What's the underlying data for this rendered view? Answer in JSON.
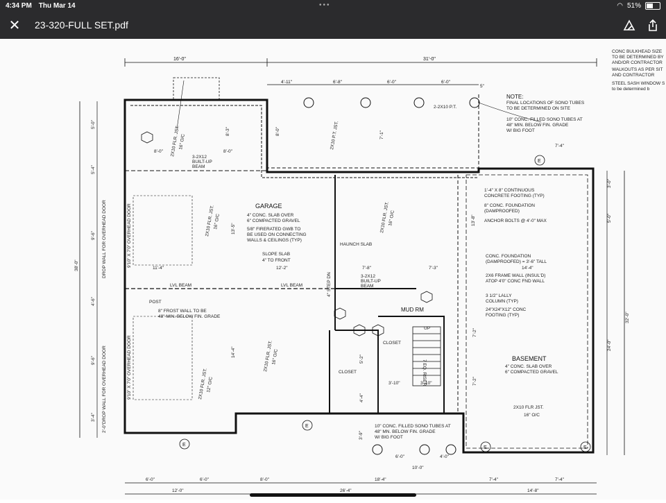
{
  "status_bar": {
    "time": "4:34 PM",
    "date": "Thu Mar 14",
    "battery": "51%",
    "battery_level": 0.51,
    "center_dots": "•••"
  },
  "toolbar": {
    "title": "23-320-FULL SET.pdf",
    "close_icon": "close-icon",
    "markup_icon": "markup-pen-icon",
    "share_icon": "share-icon"
  },
  "drawing": {
    "top_dims": {
      "left": "16'-0\"",
      "right": "31'-0\""
    },
    "top_sub_dims": [
      "4'-11\"",
      "6'-8\"",
      "6'-0\"",
      "6'-0\"",
      "5\""
    ],
    "right_notes": [
      "CONC BULKHEAD SIZE",
      "TO BE DETERMINED BY",
      "AND/OR CONTRACTOR",
      "WALKOUTS AS PER SIT",
      "AND CONTRACTOR",
      "STEEL SASH WINDOW S",
      "to be determined b"
    ],
    "note": {
      "heading": "NOTE:",
      "line1": "FINAL LOCATIONS OF SONO TUBES",
      "line2": "TO BE DETERMINED ON SITE"
    },
    "sono_note_top": [
      "10\" CONC. FILLED SONO TUBES AT",
      "48\" MIN. BELOW FIN. GRADE",
      "W/ BIG FOOT"
    ],
    "ptb": "2-2X10 P.T.",
    "garage": {
      "title": "GARAGE",
      "slab1": "4\" CONC. SLAB OVER",
      "slab2": "6\" COMPACTED GRAVEL",
      "gwb1": "5/8\" FIRERATED GWB TO",
      "gwb2": "BE USED ON CONNECTING",
      "gwb3": "WALLS & CEILINGS (TYP)",
      "slope1": "SLOPE SLAB",
      "slope2": "4\" TO FRONT"
    },
    "basement": {
      "title": "BASEMENT",
      "slab1": "4\" CONC. SLAB OVER",
      "slab2": "6\" COMPACTED GRAVEL",
      "joist": "2X10 FLR JST.",
      "oc": "16\" O/C"
    },
    "basement_notes": [
      "1'-4\" X 8\" CONTINUOUS",
      "CONCRETE FOOTING (TYP)",
      "8\" CONC. FOUNDATION",
      "(DAMPROOFED)",
      "ANCHOR BOLTS @ 4'-0\" MAX",
      "CONC. FOUNDATION",
      "(DAMPROOFED) = 3'-6\" TALL",
      "2X6 FRAME WALL (INSUL'D)",
      "ATOP 4'0\" CONC FND WALL",
      "3 1/2\" LALLY",
      "COLUMN (TYP)",
      "24\"X24\"X12\" CONC",
      "FOOTING (TYP)"
    ],
    "labels": {
      "lvl_beam": "LVL BEAM",
      "built_up1": "3-2X12",
      "built_up2": "BUILT-UP",
      "built_up3": "BEAM",
      "haunch": "HAUNCH SLAB",
      "mud_rm": "MUD RM",
      "closet": "CLOSET",
      "up": "UP",
      "post": "POST",
      "frost1": "8\" FROST WALL TO BE",
      "frost2": "48\" MIN. BELOW FIN. GRADE",
      "riser": "7 EQ. RISER",
      "step": "4\" STEP DN",
      "flr_jst": "2X10 FLR. JST.",
      "oc16": "16\" O/C",
      "oc12": "12\" O/C",
      "pt_jst": "2X10 P.T. JST.",
      "drop1": "DROP WALL FOR OVERHEAD DOOR",
      "door": "9'10\" X 7'0\" OVERHEAD DOOR"
    },
    "sono_note_bottom": [
      "10\" CONC. FILLED SONO TUBES AT",
      "48\" MN. BELOW FIN. GRADE",
      "W/ BIG FOOT"
    ],
    "bottom_dims": [
      "6'-0\"",
      "6'-0\"",
      "8'-0\"",
      "18'-4\"",
      "7'-4\"",
      "7'-4\""
    ],
    "bottom_totals": [
      "12'-0\"",
      "26'-4\"",
      "14'-8\""
    ],
    "left_dims": [
      "5'-0\"",
      "5'-4\"",
      "9'-6\"",
      "4'-6\"",
      "9'-6\"",
      "3'-4\"",
      "2'-0\""
    ],
    "left_total": "38'-0\"",
    "right_dims": [
      "3'-0\"",
      "5'-0\"",
      "32'-0\"",
      "24'-0\""
    ],
    "inner_dims": [
      "8'-3\"",
      "8'-0\"",
      "8'-0\"",
      "8'-0\"",
      "7'-1\"",
      "13'-5\"",
      "12'-2\"",
      "11'-4\"",
      "7'-8\"",
      "7'-3\"",
      "14'-4\"",
      "13'-8\"",
      "14'-4\"",
      "5'-2\"",
      "4'-4\"",
      "3'-10\"",
      "3'-10\"",
      "7'-2\"",
      "7'-2\"",
      "7'-4\"",
      "6'-0\"",
      "4'-0\"",
      "10'-0\"",
      "3'-9\""
    ]
  }
}
